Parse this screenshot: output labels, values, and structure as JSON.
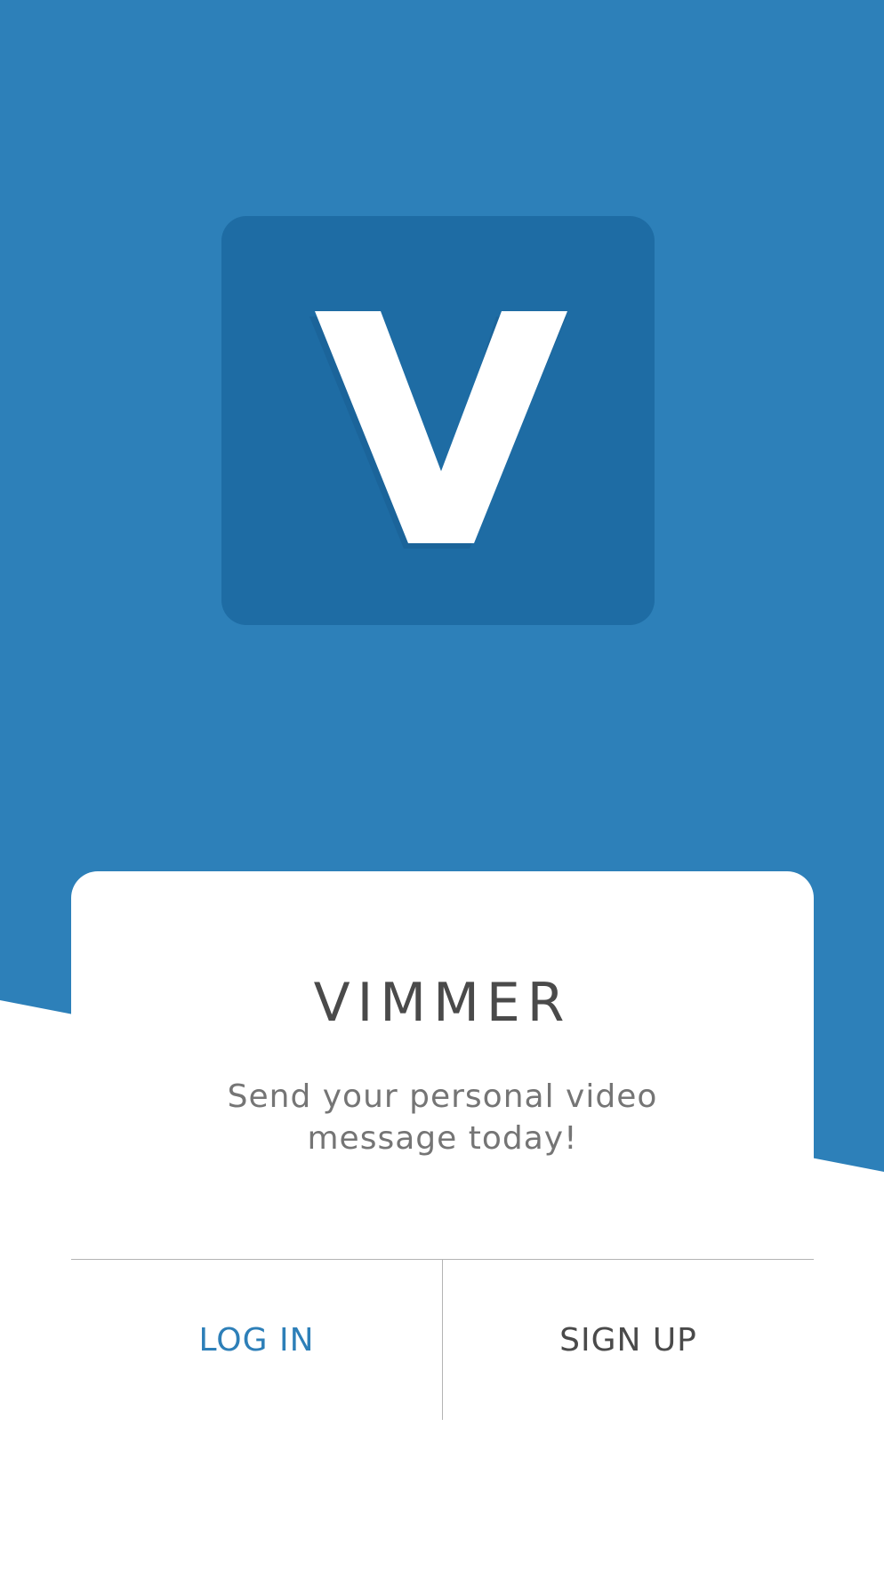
{
  "colors": {
    "primary": "#2d80b9",
    "logo_box": "#1e6ca4",
    "card": "#ffffff",
    "title_text": "#4a4a4a",
    "tagline_text": "#757575",
    "login_text": "#2d7fb8",
    "signup_text": "#4a4a4a"
  },
  "logo": {
    "icon": "v-logo-icon",
    "letter": "V"
  },
  "card": {
    "app_name": "VIMMER",
    "tagline": "Send your personal video message today!"
  },
  "actions": {
    "login_label": "LOG IN",
    "signup_label": "SIGN UP"
  }
}
